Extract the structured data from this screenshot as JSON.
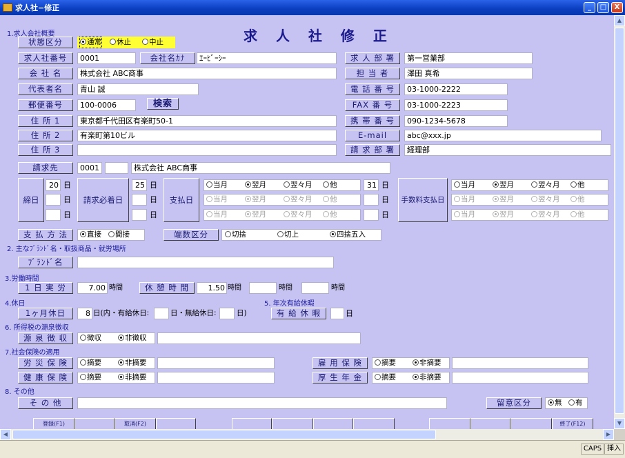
{
  "window": {
    "title": "求人社−修正",
    "min": "_",
    "max": "□",
    "close": "X"
  },
  "form": {
    "title": "求 人 社 修 正"
  },
  "sections": {
    "s1": "1.求人会社概要",
    "s2": "2. 主なﾌﾞﾗﾝﾄﾞ名・取扱商品・就労場所",
    "s3": "3.労働時間",
    "s4": "4.休日",
    "s5": "5. 年次有給休暇",
    "s6": "6. 所得税の源泉徴収",
    "s7": "7.社会保険の適用",
    "s8": "8. その他"
  },
  "status": {
    "label": "状態区分",
    "options": [
      "通常",
      "休止",
      "中止"
    ],
    "selected": 0
  },
  "fields": {
    "company_no": {
      "label": "求人社番号",
      "value": "0001"
    },
    "kana": {
      "label": "会社名ｶﾅ",
      "value": "ｴｰﾋﾞｰｼｰ"
    },
    "company": {
      "label": "会 社 名",
      "value": "株式会社 ABC商事"
    },
    "rep": {
      "label": "代表者名",
      "value": "青山 誠"
    },
    "zip": {
      "label": "郵便番号",
      "value": "100-0006",
      "search": "検索"
    },
    "addr1": {
      "label": "住 所 1",
      "value": "東京都千代田区有楽町50-1"
    },
    "addr2": {
      "label": "住 所 2",
      "value": "有楽町第10ビル"
    },
    "addr3": {
      "label": "住 所 3",
      "value": ""
    },
    "dept": {
      "label": "求 人 部 署",
      "value": "第一営業部"
    },
    "person": {
      "label": "担 当 者",
      "value": "澤田 真希"
    },
    "tel": {
      "label": "電 話 番 号",
      "value": "03-1000-2222"
    },
    "fax": {
      "label": "FAX 番 号",
      "value": "03-1000-2223"
    },
    "mobile": {
      "label": "携 帯 番 号",
      "value": "090-1234-5678"
    },
    "email": {
      "label": "E-mail",
      "value": "abc@xxx.jp"
    },
    "billing_dept": {
      "label": "請 求 部 署",
      "value": "経理部"
    },
    "bill_to": {
      "label": "請求先",
      "code": "0001",
      "code2": "",
      "name": "株式会社 ABC商事"
    }
  },
  "closing": {
    "label": "締日",
    "rows": [
      "20",
      "",
      ""
    ],
    "unit": "日"
  },
  "must": {
    "label": "請求必着日",
    "rows": [
      "25",
      "",
      ""
    ],
    "unit": "日"
  },
  "pay": {
    "label": "支払日",
    "rows": [
      "31",
      "",
      ""
    ],
    "unit": "日",
    "options": [
      "当月",
      "翌月",
      "翌々月",
      "他"
    ],
    "selected": 1
  },
  "fee": {
    "label": "手数料支払日",
    "options": [
      "当月",
      "翌月",
      "翌々月",
      "他"
    ],
    "selected": 1
  },
  "pay_method": {
    "label": "支 払 方 法",
    "options": [
      "直接",
      "間接"
    ],
    "selected": 0
  },
  "rounding": {
    "label": "端数区分",
    "options": [
      "切捨",
      "切上",
      "四捨五入"
    ],
    "selected": 2
  },
  "brand": {
    "label": "ﾌﾞﾗﾝﾄﾞ名",
    "value": ""
  },
  "work": {
    "label": "1 日 実 労",
    "hours": "7.00",
    "unit": "時間",
    "rest_label": "休 憩 時 間",
    "rest": "1.50",
    "extra1": "",
    "extra2": ""
  },
  "holiday": {
    "label": "1ヶ月休日",
    "value": "8",
    "text1": "日(内・有給休日:",
    "paid": "",
    "text2": "日・無給休日:",
    "unpaid": "",
    "text3": "日)"
  },
  "leave": {
    "label": "有 給 休 暇",
    "value": "",
    "unit": "日"
  },
  "tax": {
    "label": "源 泉 徴 収",
    "options": [
      "徴収",
      "非徴収"
    ],
    "selected": 1,
    "note": ""
  },
  "ins": {
    "rosai": "労 災 保 険",
    "kenko": "健 康 保 険",
    "koyo": "雇 用 保 険",
    "kosei": "厚 生 年 金",
    "options": [
      "摘要",
      "非摘要"
    ],
    "selected": 1
  },
  "other": {
    "label": "そ の 他",
    "value": ""
  },
  "caution": {
    "label": "留意区分",
    "options": [
      "無",
      "有"
    ],
    "selected": 0
  },
  "bottom": [
    "登録(F1)",
    "取消(F2)",
    "終了(F12)"
  ],
  "statusbar": {
    "caps": "CAPS",
    "ins": "挿入"
  }
}
